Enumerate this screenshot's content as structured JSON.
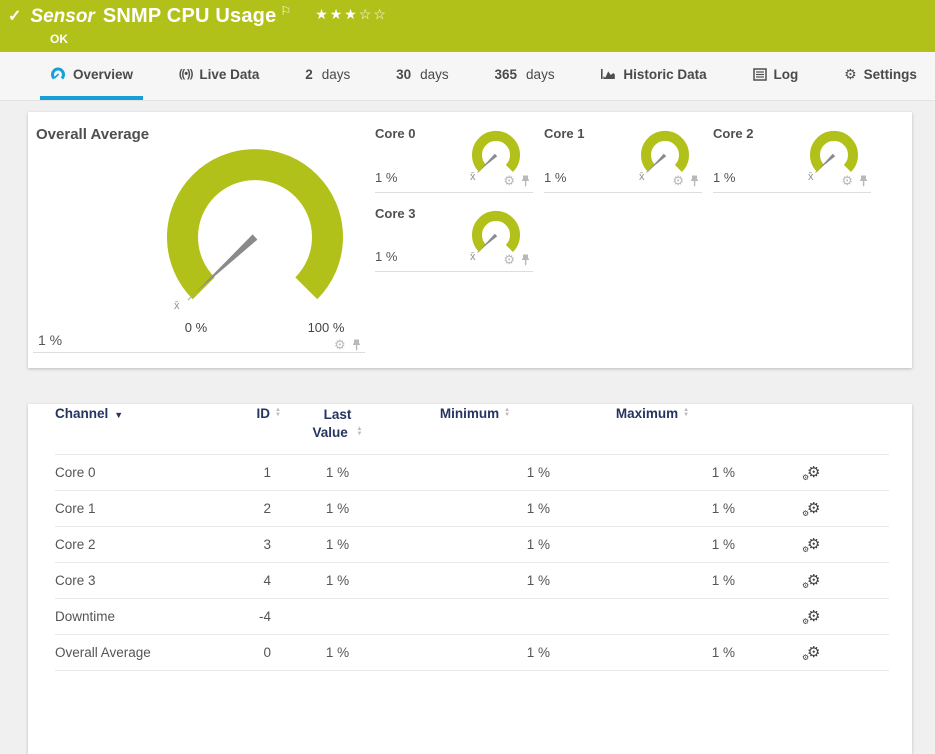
{
  "header": {
    "kind_label": "Sensor",
    "title": "SNMP CPU Usage",
    "status": "OK",
    "stars": "★★★☆☆",
    "rating_filled": 3,
    "rating_total": 5,
    "icons": [
      "check-icon",
      "flag-icon"
    ]
  },
  "tabs": [
    {
      "label": "Overview",
      "icon": "gauge-icon",
      "active": true
    },
    {
      "label": "Live Data",
      "icon": "live-data-icon"
    },
    {
      "num": "2",
      "label": "days"
    },
    {
      "num": "30",
      "label": "days"
    },
    {
      "num": "365",
      "label": "days"
    },
    {
      "label": "Historic Data",
      "icon": "area-chart-icon"
    },
    {
      "label": "Log",
      "icon": "log-list-icon"
    },
    {
      "label": "Settings",
      "icon": "gear-icon"
    }
  ],
  "gauges": {
    "panel_icons": [
      "gear-icon",
      "pin-icon"
    ],
    "overall": {
      "title": "Overall Average",
      "value": "1 %",
      "percent": 1,
      "min_label": "0 %",
      "max_label": "100 %",
      "mean_marker": "x̄"
    },
    "cores": [
      {
        "title": "Core 0",
        "value": "1 %",
        "percent": 1
      },
      {
        "title": "Core 1",
        "value": "1 %",
        "percent": 1
      },
      {
        "title": "Core 2",
        "value": "1 %",
        "percent": 1
      },
      {
        "title": "Core 3",
        "value": "1 %",
        "percent": 1
      }
    ]
  },
  "table": {
    "columns": [
      {
        "label": "Channel",
        "sorted": "desc"
      },
      {
        "label": "ID"
      },
      {
        "label": "Last Value"
      },
      {
        "label": "Minimum"
      },
      {
        "label": "Maximum"
      }
    ],
    "rows": [
      {
        "channel": "Core 0",
        "id": "1",
        "last": "1 %",
        "min": "1 %",
        "max": "1 %"
      },
      {
        "channel": "Core 1",
        "id": "2",
        "last": "1 %",
        "min": "1 %",
        "max": "1 %"
      },
      {
        "channel": "Core 2",
        "id": "3",
        "last": "1 %",
        "min": "1 %",
        "max": "1 %"
      },
      {
        "channel": "Core 3",
        "id": "4",
        "last": "1 %",
        "min": "1 %",
        "max": "1 %"
      },
      {
        "channel": "Downtime",
        "id": "-4",
        "last": "",
        "min": "",
        "max": ""
      },
      {
        "channel": "Overall Average",
        "id": "0",
        "last": "1 %",
        "min": "1 %",
        "max": "1 %"
      }
    ]
  },
  "colors": {
    "accent_green": "#b2c11a",
    "accent_blue": "#17a0d8",
    "table_header_navy": "#263560",
    "status_ok_text": "#ffffff"
  }
}
